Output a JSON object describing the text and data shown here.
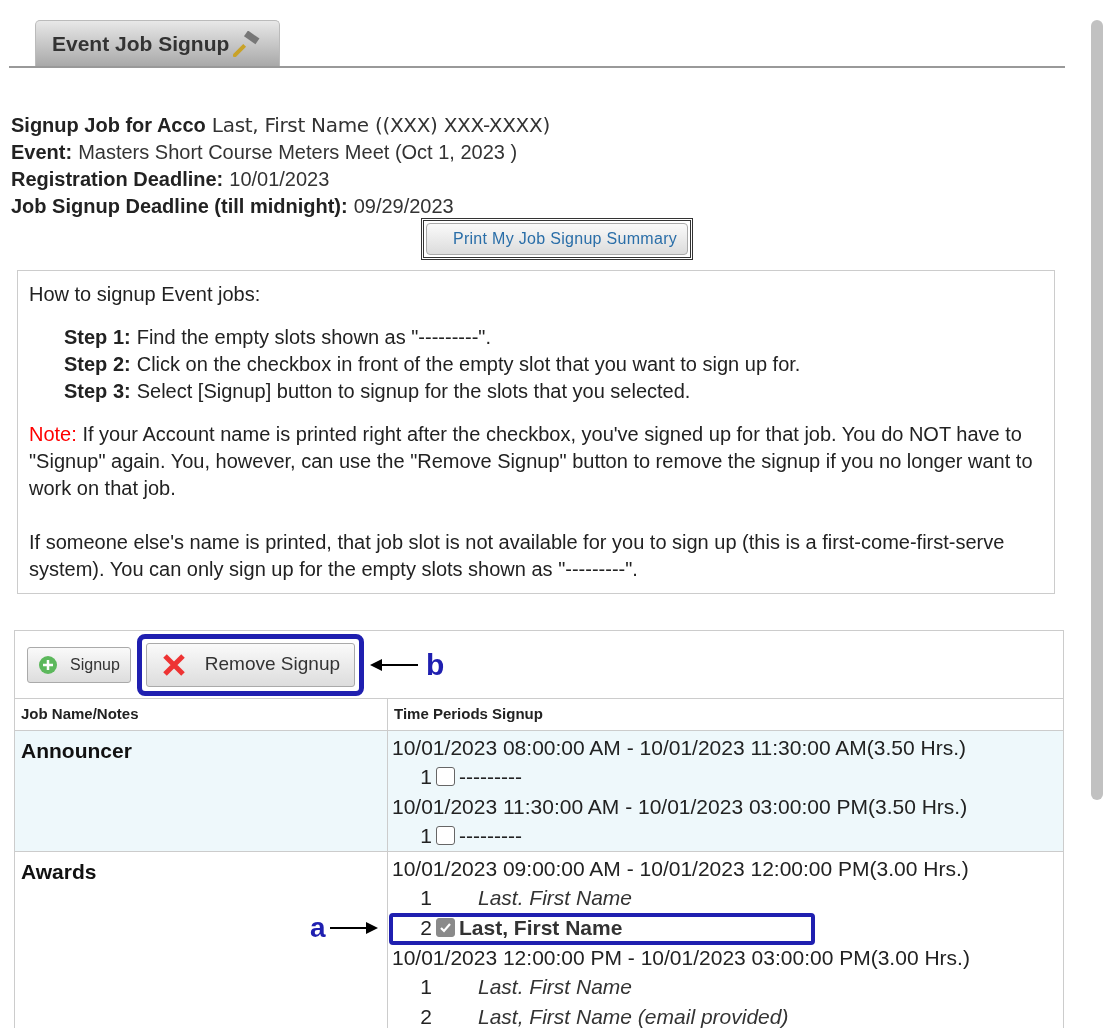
{
  "tab": {
    "label": "Event Job Signup",
    "selected": true
  },
  "info": [
    {
      "label": "Signup Job for Acco",
      "value": "Last, First Name ((XXX) XXX-XXXX)",
      "kind": "overlay"
    },
    {
      "label": "Event:",
      "value": "Masters Short Course Meters Meet (Oct 1, 2023 )",
      "kind": "plain"
    },
    {
      "label": "Registration Deadline:",
      "value": "10/01/2023",
      "kind": "plain"
    },
    {
      "label": "Job Signup Deadline (till midnight):",
      "value": "09/29/2023",
      "kind": "plain"
    }
  ],
  "print_button": "Print My Job Signup Summary",
  "instructions": {
    "intro": "How to signup Event jobs:",
    "steps": [
      {
        "label": "Step 1:",
        "text": "Find the empty slots shown as \"---------\"."
      },
      {
        "label": "Step 2:",
        "text": "Click on the checkbox in front of the empty slot that you want to sign up for."
      },
      {
        "label": "Step 3:",
        "text": "Select [Signup] button to signup for the slots that you selected."
      }
    ],
    "note_label": "Note:",
    "note": "If your Account name is printed right after the checkbox, you've signed up for that job. You do NOT have to \"Signup\" again. You, however, can use the \"Remove Signup\" button to remove the signup if you no longer want to work on that job.",
    "paragraph": "If someone else's name is printed, that job slot is not available for you to sign up (this is a first-come-first-serve system). You can only sign up for the empty slots shown as \"---------\"."
  },
  "toolbar": [
    {
      "label": "Signup",
      "kind": "add"
    },
    {
      "label": "Remove Signup",
      "kind": "remove",
      "callout": "b"
    }
  ],
  "columns": [
    "Job Name/Notes",
    "Time Periods Signup"
  ],
  "jobs": [
    {
      "name": "Announcer",
      "selected": true,
      "periods": [
        {
          "time": "10/01/2023 08:00:00 AM - 10/01/2023 11:30:00 AM(3.50 Hrs.)",
          "slots": [
            {
              "number": "1",
              "kind": "checkbox",
              "checked": false,
              "name": "---------"
            }
          ]
        },
        {
          "time": "10/01/2023 11:30:00 AM - 10/01/2023 03:00:00 PM(3.50 Hrs.)",
          "slots": [
            {
              "number": "1",
              "kind": "checkbox",
              "checked": false,
              "name": "---------"
            }
          ]
        }
      ]
    },
    {
      "name": "Awards",
      "selected": false,
      "periods": [
        {
          "time": "10/01/2023 09:00:00 AM - 10/01/2023 12:00:00 PM(3.00 Hrs.)",
          "slots": [
            {
              "number": "1",
              "kind": "taken",
              "name": "Last. First Name"
            },
            {
              "number": "2",
              "kind": "checkbox",
              "checked": true,
              "name": "Last, First Name",
              "callout": "a"
            }
          ]
        },
        {
          "time": "10/01/2023 12:00:00 PM - 10/01/2023 03:00:00 PM(3.00 Hrs.)",
          "slots": [
            {
              "number": "1",
              "kind": "taken",
              "name": "Last. First Name"
            },
            {
              "number": "2",
              "kind": "taken",
              "name": "Last, First Name (email provided)"
            }
          ]
        }
      ]
    }
  ]
}
